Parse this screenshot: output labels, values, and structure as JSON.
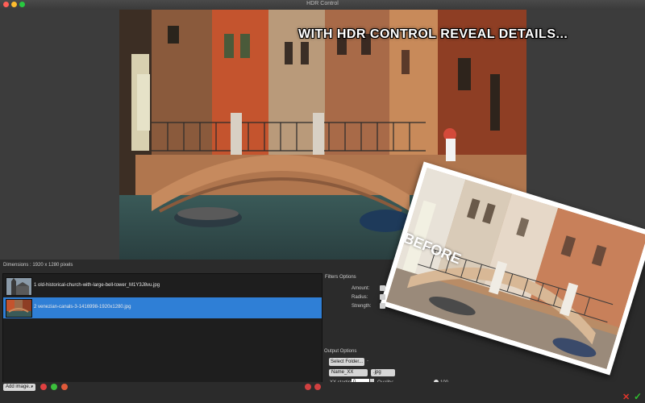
{
  "window": {
    "title": "HDR Control"
  },
  "preview": {
    "headline": "WITH HDR CONTROL REVEAL DETAILS...",
    "before_label": "BEFORE"
  },
  "info": {
    "dimensions": "Dimensions : 1920 x 1280 pixels"
  },
  "files": [
    {
      "label": "1 old-historical-church-with-large-bell-tower_M1Y3J8vu.jpg",
      "selected": false
    },
    {
      "label": "2 venezian-canals-3-1416998-1920x1280.jpg",
      "selected": true
    }
  ],
  "toolbar": {
    "add_image": "Add image..."
  },
  "filters": {
    "title": "Filters Options",
    "amount": "Amount:",
    "radius": "Radius:",
    "strength": "Strength:"
  },
  "output": {
    "title": "Output Options",
    "select_folder": "Select Folder...",
    "folder_path": "-",
    "name_format": "Name_XX",
    "extension": ".jpg",
    "xx_starting_label": "XX starting:",
    "xx_starting_value": "0",
    "quality_label": "Quality:",
    "quality_value": "100"
  },
  "colors": {
    "accent": "#2f7fd6",
    "cancel": "#e0352b",
    "ok": "#2fbf2f"
  }
}
